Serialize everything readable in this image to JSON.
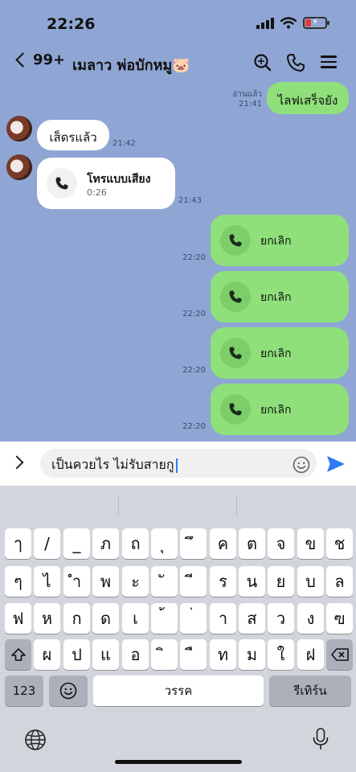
{
  "status": {
    "time": "22:26"
  },
  "header": {
    "back_count": "99+",
    "title": "เมลาว พ่อบักหมู🐷"
  },
  "messages": {
    "m1": {
      "text": "ไลฟเสร็จยัง",
      "read": "อ่านแล้ว",
      "time": "21:41"
    },
    "m2": {
      "text": "เส็ดรแล้ว",
      "time": "21:42"
    },
    "m3": {
      "title": "โทรแบบเสียง",
      "duration": "0:26",
      "time": "21:43"
    },
    "m4": {
      "label": "ยกเลิก",
      "time": "22:20"
    },
    "m5": {
      "label": "ยกเลิก",
      "time": "22:20"
    },
    "m6": {
      "label": "ยกเลิก",
      "time": "22:20"
    },
    "m7": {
      "label": "ยกเลิก",
      "time": "22:20"
    }
  },
  "input": {
    "value": "เป็นควยไร ไม่รับสายกู"
  },
  "keyboard": {
    "row1": [
      "ๅ",
      "/",
      "_",
      "ภ",
      "ถ",
      "ุ",
      "ึ",
      "ค",
      "ต",
      "จ",
      "ข",
      "ช"
    ],
    "row2": [
      "ๆ",
      "ไ",
      "ำ",
      "พ",
      "ะ",
      "ั",
      "ี",
      "ร",
      "น",
      "ย",
      "บ",
      "ล"
    ],
    "row3": [
      "ฟ",
      "ห",
      "ก",
      "ด",
      "เ",
      "้",
      "่",
      "า",
      "ส",
      "ว",
      "ง",
      "ฃ"
    ],
    "row4": [
      "ผ",
      "ป",
      "แ",
      "อ",
      "ิ",
      "ื",
      "ท",
      "ม",
      "ใ",
      "ฝ"
    ],
    "numbers_label": "123",
    "space_label": "วรรค",
    "return_label": "รีเทิร์น"
  },
  "colors": {
    "chat_bg": "#8fa6d4",
    "my_bubble": "#8fe07b",
    "send": "#2f7cf6"
  }
}
